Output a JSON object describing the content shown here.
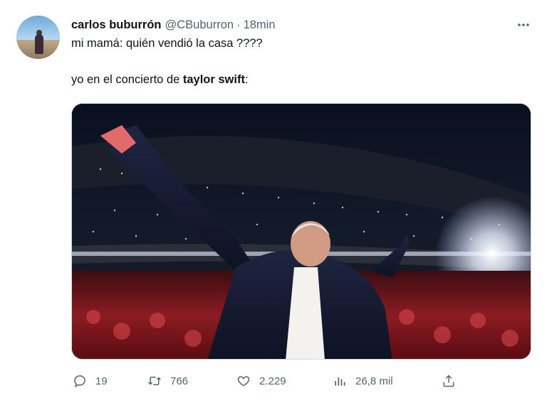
{
  "author": {
    "name": "carlos buburrón",
    "handle": "@CBuburron",
    "separator": "·",
    "time": "18min"
  },
  "tweet": {
    "line1": "mi mamá: quién vendió la casa ????",
    "line2_prefix": "yo en el concierto de ",
    "line2_bold": "taylor swift",
    "line2_suffix": ":"
  },
  "media": {
    "description_icon": "photo"
  },
  "actions": {
    "replies": "19",
    "retweets": "766",
    "likes": "2.229",
    "views": "26,8 mil"
  },
  "icons": {
    "more": "more-horizontal-icon",
    "reply": "reply-icon",
    "retweet": "retweet-icon",
    "like": "heart-icon",
    "views": "views-icon",
    "share": "share-icon"
  },
  "colors": {
    "text": "#0f1419",
    "secondary": "#536471",
    "border": "#cfd9de"
  }
}
